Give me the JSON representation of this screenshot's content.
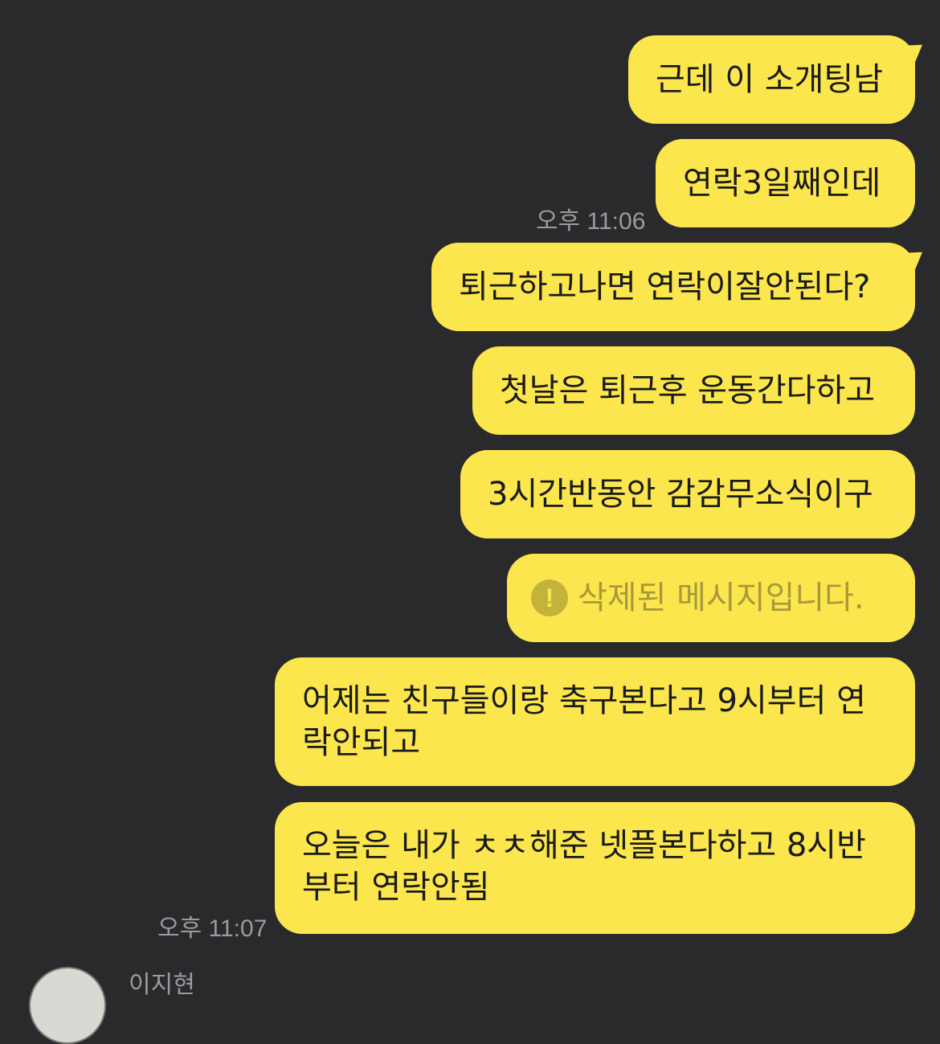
{
  "messages": [
    {
      "text": "근데 이 소개팅남"
    },
    {
      "text": "연락3일째인데"
    },
    {
      "text": "퇴근하고나면 연락이잘안된다?"
    },
    {
      "text": "첫날은 퇴근후 운동간다하고"
    },
    {
      "text": "3시간반동안 감감무소식이구"
    },
    {
      "text": "삭제된 메시지입니다.",
      "icon": "exclamation-circle-icon"
    },
    {
      "text": "어제는 친구들이랑 축구본다고 9시부터 연락안되고"
    },
    {
      "text": "오늘은 내가 ㅊㅊ해준 넷플본다하고 8시반부터 연락안됨"
    }
  ],
  "timestamps": {
    "first_group": "오후 11:06",
    "second_group": "오후 11:07"
  },
  "partner": {
    "name": "이지현"
  },
  "colors": {
    "background": "#2a2a2c",
    "bubble": "#fbe64d",
    "text": "#1a1a1a",
    "timestamp": "#9b9b9f"
  }
}
